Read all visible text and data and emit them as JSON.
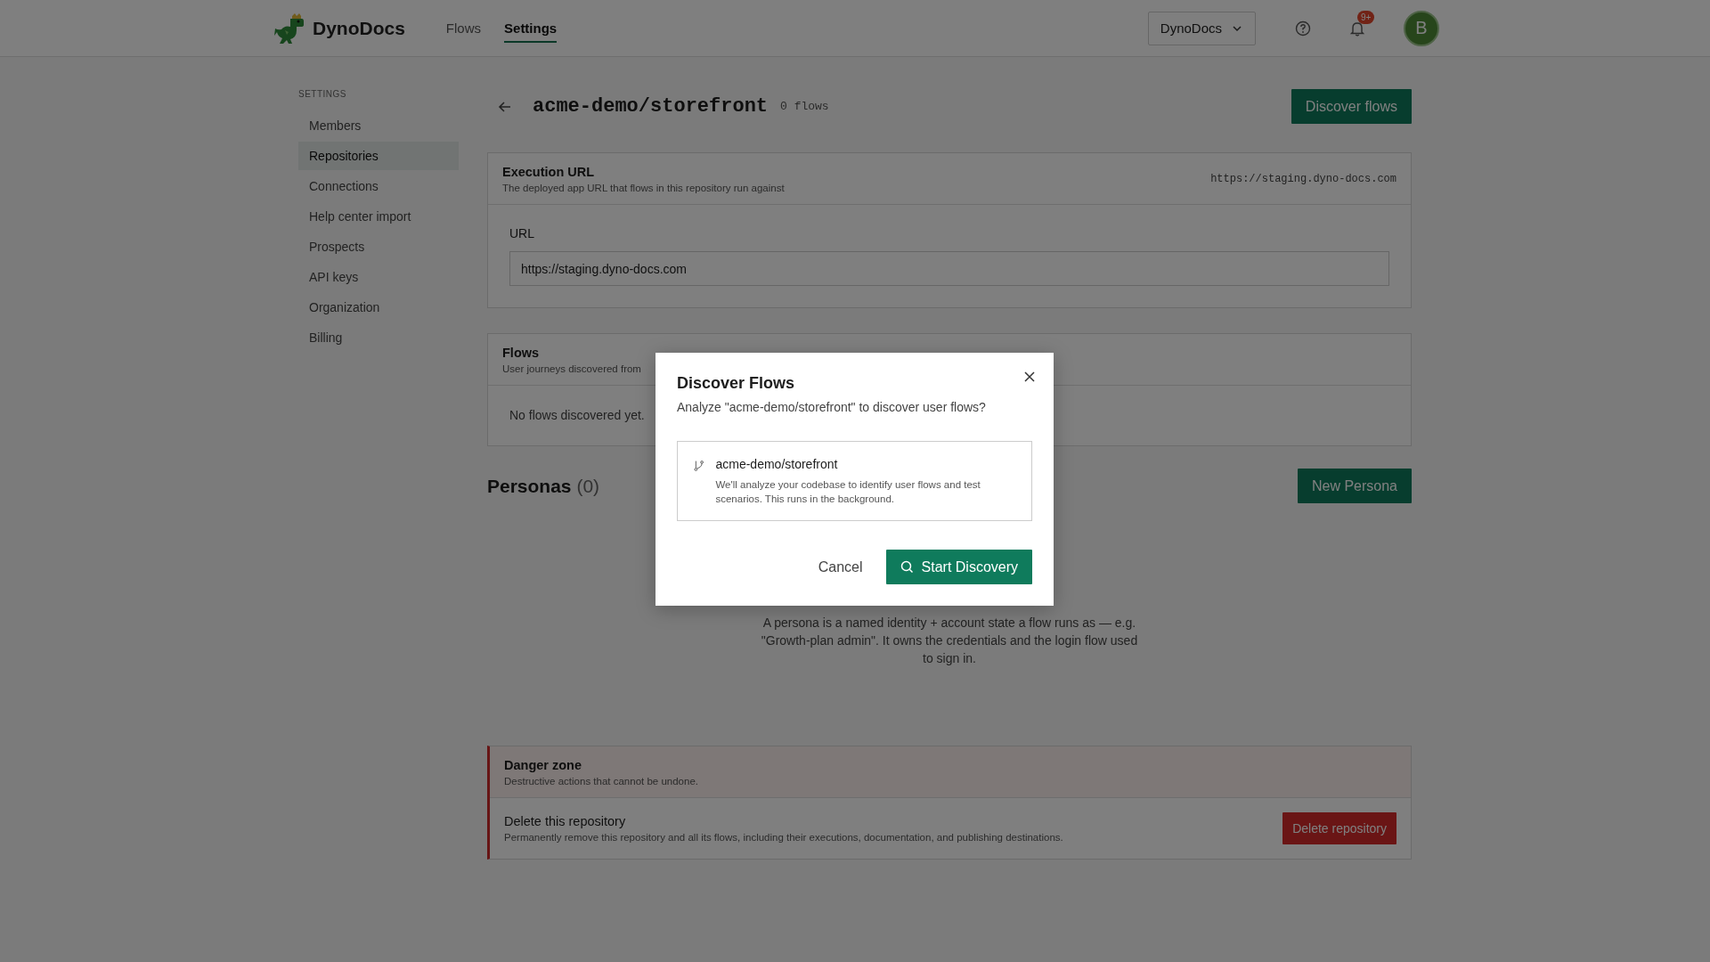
{
  "header": {
    "brand": "DynoDocs",
    "nav": [
      {
        "label": "Flows",
        "selected": false
      },
      {
        "label": "Settings",
        "selected": true
      }
    ],
    "workspace": "DynoDocs",
    "notifications": "9+",
    "avatar": "B"
  },
  "sidebar": {
    "heading": "SETTINGS",
    "items": [
      {
        "label": "Members",
        "selected": false
      },
      {
        "label": "Repositories",
        "selected": true
      },
      {
        "label": "Connections",
        "selected": false
      },
      {
        "label": "Help center import",
        "selected": false
      },
      {
        "label": "Prospects",
        "selected": false
      },
      {
        "label": "API keys",
        "selected": false
      },
      {
        "label": "Organization",
        "selected": false
      },
      {
        "label": "Billing",
        "selected": false
      }
    ]
  },
  "page": {
    "title": "acme-demo/storefront",
    "flow_count": "0 flows",
    "discover_button": "Discover flows"
  },
  "execution_url": {
    "title": "Execution URL",
    "subtitle": "The deployed app URL that flows in this repository run against",
    "value": "https://staging.dyno-docs.com",
    "field_label": "URL",
    "field_value": "https://staging.dyno-docs.com"
  },
  "flows": {
    "title": "Flows",
    "subtitle": "User journeys discovered from",
    "empty": "No flows discovered yet."
  },
  "personas": {
    "title": "Personas",
    "count": "(0)",
    "button": "New Persona",
    "description": "A persona is a named identity + account state a flow runs as — e.g. \"Growth-plan admin\". It owns the credentials and the login flow used to sign in."
  },
  "danger_zone": {
    "title": "Danger zone",
    "subtitle": "Destructive actions that cannot be undone.",
    "row_title": "Delete this repository",
    "row_description": "Permanently remove this repository and all its flows, including their executions, documentation, and publishing destinations.",
    "button": "Delete repository"
  },
  "modal": {
    "title": "Discover Flows",
    "question": "Analyze \"acme-demo/storefront\" to discover user flows?",
    "repo_name": "acme-demo/storefront",
    "repo_description": "We'll analyze your codebase to identify user flows and test scenarios. This runs in the background.",
    "cancel": "Cancel",
    "confirm": "Start Discovery"
  }
}
